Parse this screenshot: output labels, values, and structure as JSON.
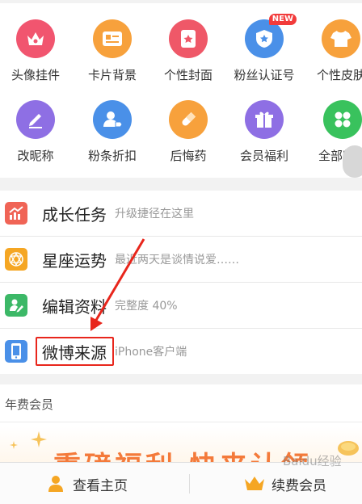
{
  "grid": {
    "items": [
      {
        "label": "头像挂件",
        "icon": "crown-icon",
        "color": "#f1556f"
      },
      {
        "label": "卡片背景",
        "icon": "card-icon",
        "color": "#f7a13c"
      },
      {
        "label": "个性封面",
        "icon": "cover-icon",
        "color": "#ef5868"
      },
      {
        "label": "粉丝认证号",
        "icon": "verified-shield-icon",
        "color": "#4a90e8",
        "badge": "NEW"
      },
      {
        "label": "个性皮肤",
        "icon": "shirt-icon",
        "color": "#f7a13c"
      },
      {
        "label": "改昵称",
        "icon": "pencil-icon",
        "color": "#8e6fe4"
      },
      {
        "label": "粉条折扣",
        "icon": "user-tag-icon",
        "color": "#4a90e8"
      },
      {
        "label": "后悔药",
        "icon": "pill-icon",
        "color": "#f7a13c"
      },
      {
        "label": "会员福利",
        "icon": "gift-icon",
        "color": "#8e6fe4"
      },
      {
        "label": "全部特权",
        "icon": "grid-dots-icon",
        "color": "#39c25d"
      }
    ]
  },
  "list": {
    "rows": [
      {
        "title": "成长任务",
        "subtitle": "升级捷径在这里",
        "icon": "growth-chart-icon",
        "color": "#f06456"
      },
      {
        "title": "星座运势",
        "subtitle": "最近两天是谈情说爱……",
        "icon": "star-sign-icon",
        "color": "#f5a623"
      },
      {
        "title": "编辑资料",
        "subtitle": "完整度 40%",
        "icon": "edit-profile-icon",
        "color": "#3cb867"
      },
      {
        "title": "微博来源",
        "subtitle": "iPhone客户端",
        "icon": "phone-icon",
        "color": "#4a90e8"
      }
    ]
  },
  "vip": {
    "title": "年费会员",
    "banner": "重磅福利 快来认领"
  },
  "tabbar": {
    "home": "查看主页",
    "renew": "续费会员"
  },
  "watermark": "Baidu经验",
  "colors": {
    "annotation": "#e8261c"
  }
}
